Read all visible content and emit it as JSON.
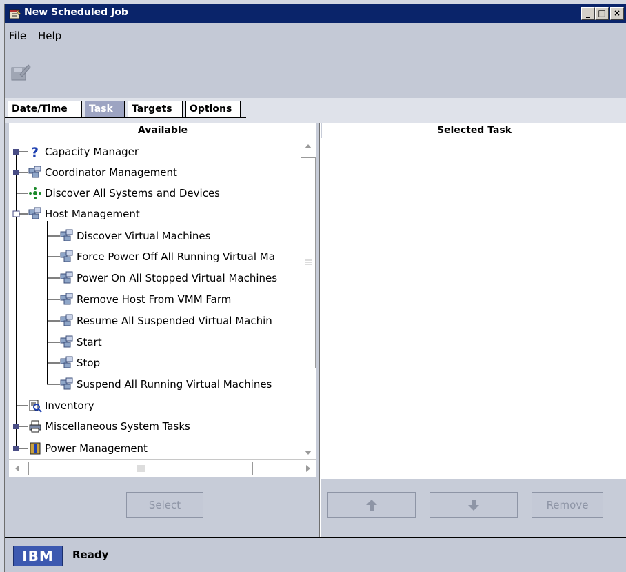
{
  "window": {
    "title": "New Scheduled Job",
    "controls": {
      "minimize": "_",
      "maximize": "□",
      "close": "×"
    }
  },
  "menubar": {
    "items": [
      "File",
      "Help"
    ]
  },
  "toolbar": {
    "save_icon": "save-icon"
  },
  "tabs": [
    {
      "label": "Date/Time",
      "selected": false
    },
    {
      "label": "Task",
      "selected": true
    },
    {
      "label": "Targets",
      "selected": false
    },
    {
      "label": "Options",
      "selected": false
    }
  ],
  "available": {
    "header": "Available",
    "items": [
      {
        "label": "Capacity Manager",
        "icon": "question-icon",
        "expanded": false
      },
      {
        "label": "Coordinator Management",
        "icon": "network-icon",
        "expanded": false
      },
      {
        "label": "Discover All Systems and Devices",
        "icon": "discover-icon"
      },
      {
        "label": "Host Management",
        "icon": "network-icon",
        "expanded": true
      },
      {
        "label": "Discover Virtual Machines",
        "icon": "network-icon",
        "child": true
      },
      {
        "label": "Force Power Off All Running Virtual Ma",
        "icon": "network-icon",
        "child": true
      },
      {
        "label": "Power On All Stopped Virtual Machines",
        "icon": "network-icon",
        "child": true
      },
      {
        "label": "Remove Host From VMM Farm",
        "icon": "network-icon",
        "child": true
      },
      {
        "label": "Resume All Suspended Virtual Machin",
        "icon": "network-icon",
        "child": true
      },
      {
        "label": "Start",
        "icon": "network-icon",
        "child": true
      },
      {
        "label": "Stop",
        "icon": "network-icon",
        "child": true
      },
      {
        "label": "Suspend All Running Virtual Machines",
        "icon": "network-icon",
        "child": true
      },
      {
        "label": "Inventory",
        "icon": "inventory-icon"
      },
      {
        "label": "Miscellaneous System Tasks",
        "icon": "printer-icon",
        "expanded": false
      },
      {
        "label": "Power Management",
        "icon": "power-icon",
        "expanded": false
      }
    ],
    "select_button": "Select"
  },
  "selected": {
    "header": "Selected Task",
    "up_icon": "arrow-up-icon",
    "down_icon": "arrow-down-icon",
    "remove_button": "Remove"
  },
  "status": {
    "logo": "IBM",
    "text": "Ready"
  },
  "colors": {
    "titlebar": "#0a246a",
    "selected_tab": "#9da4c2",
    "panel": "#c4c9d6"
  }
}
